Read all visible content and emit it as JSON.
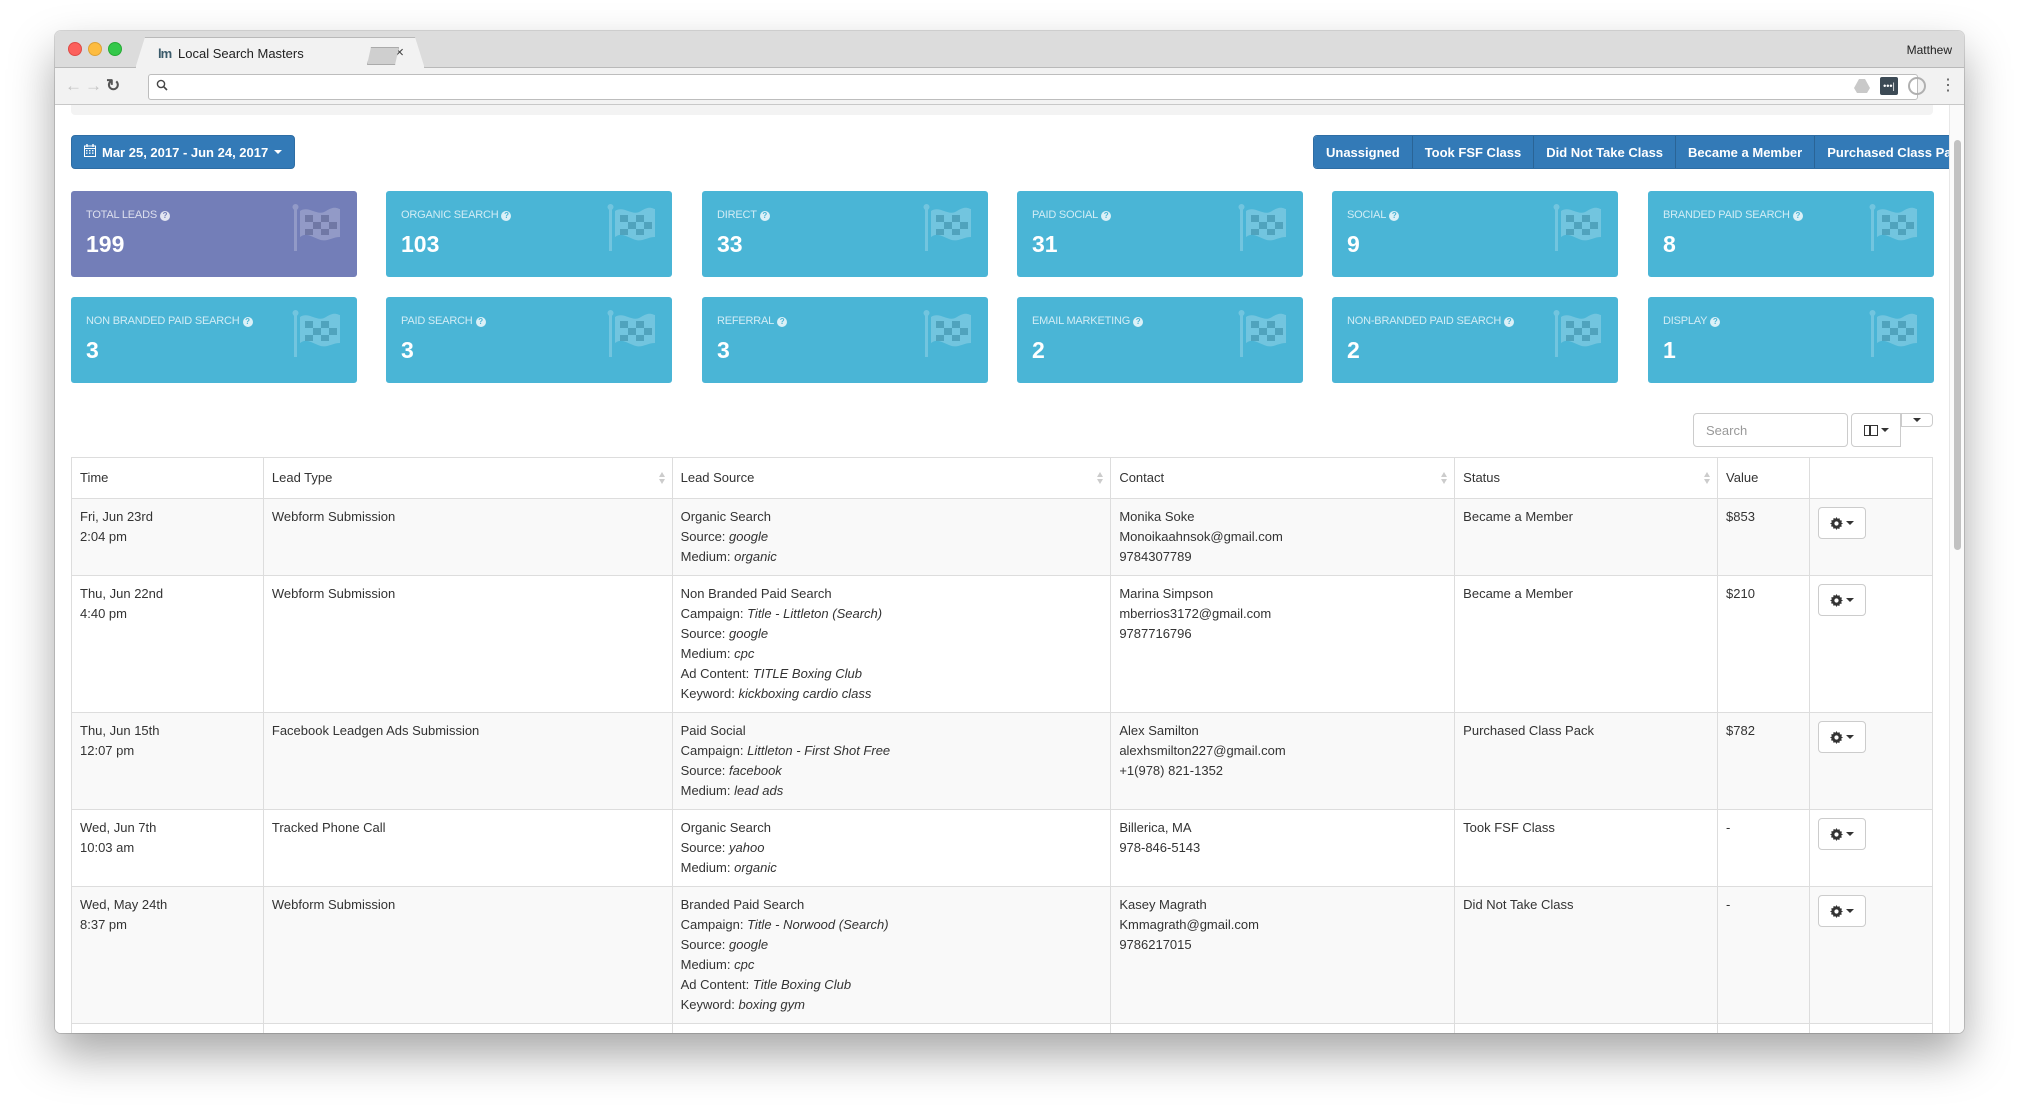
{
  "browser": {
    "tab_title": "Local Search Masters",
    "tab_favicon": "lm",
    "profile_name": "Matthew",
    "address_value": ""
  },
  "toolbar": {
    "date_range": "Mar 25, 2017 - Jun 24, 2017",
    "status_filters": [
      "Unassigned",
      "Took FSF Class",
      "Did Not Take Class",
      "Became a Member",
      "Purchased Class Pack"
    ]
  },
  "colors": {
    "primary": "#337ab7",
    "card_info": "#4ab5d6",
    "card_total": "#737eb8"
  },
  "stats": [
    {
      "label": "Total Leads",
      "value": "199"
    },
    {
      "label": "Organic Search",
      "value": "103"
    },
    {
      "label": "Direct",
      "value": "33"
    },
    {
      "label": "Paid Social",
      "value": "31"
    },
    {
      "label": "Social",
      "value": "9"
    },
    {
      "label": "Branded Paid Search",
      "value": "8"
    },
    {
      "label": "Non Branded Paid Search",
      "value": "3"
    },
    {
      "label": "Paid Search",
      "value": "3"
    },
    {
      "label": "Referral",
      "value": "3"
    },
    {
      "label": "Email Marketing",
      "value": "2"
    },
    {
      "label": "Non-Branded Paid Search",
      "value": "2"
    },
    {
      "label": "Display",
      "value": "1"
    }
  ],
  "table_tools": {
    "search_placeholder": "Search",
    "search_value": ""
  },
  "table": {
    "headers": [
      "Time",
      "Lead Type",
      "Lead Source",
      "Contact",
      "Status",
      "Value"
    ],
    "rows": [
      {
        "date": "Fri, Jun 23rd",
        "time": "2:04 pm",
        "lead_type": "Webform Submission",
        "source_name": "Organic Search",
        "source_details": [
          {
            "key": "Source:",
            "val": "google"
          },
          {
            "key": "Medium:",
            "val": "organic"
          }
        ],
        "contact": [
          "Monika Soke",
          "Monoikaahnsok@gmail.com",
          "9784307789"
        ],
        "status": "Became a Member",
        "value": "$853"
      },
      {
        "date": "Thu, Jun 22nd",
        "time": "4:40 pm",
        "lead_type": "Webform Submission",
        "source_name": "Non Branded Paid Search",
        "source_details": [
          {
            "key": "Campaign:",
            "val": "Title - Littleton (Search)"
          },
          {
            "key": "Source:",
            "val": "google"
          },
          {
            "key": "Medium:",
            "val": "cpc"
          },
          {
            "key": "Ad Content:",
            "val": "TITLE Boxing Club"
          },
          {
            "key": "Keyword:",
            "val": "kickboxing cardio class"
          }
        ],
        "contact": [
          "Marina Simpson",
          "mberrios3172@gmail.com",
          "9787716796"
        ],
        "status": "Became a Member",
        "value": "$210"
      },
      {
        "date": "Thu, Jun 15th",
        "time": "12:07 pm",
        "lead_type": "Facebook Leadgen Ads Submission",
        "source_name": "Paid Social",
        "source_details": [
          {
            "key": "Campaign:",
            "val": "Littleton - First Shot Free"
          },
          {
            "key": "Source:",
            "val": "facebook"
          },
          {
            "key": "Medium:",
            "val": "lead ads"
          }
        ],
        "contact": [
          "Alex Samilton",
          "alexhsmilton227@gmail.com",
          "+1(978) 821-1352"
        ],
        "status": "Purchased Class Pack",
        "value": "$782"
      },
      {
        "date": "Wed, Jun 7th",
        "time": "10:03 am",
        "lead_type": "Tracked Phone Call",
        "source_name": "Organic Search",
        "source_details": [
          {
            "key": "Source:",
            "val": "yahoo"
          },
          {
            "key": "Medium:",
            "val": "organic"
          }
        ],
        "contact": [
          "Billerica, MA",
          "978-846-5143"
        ],
        "status": "Took FSF Class",
        "value": "-"
      },
      {
        "date": "Wed, May 24th",
        "time": "8:37 pm",
        "lead_type": "Webform Submission",
        "source_name": "Branded Paid Search",
        "source_details": [
          {
            "key": "Campaign:",
            "val": "Title - Norwood (Search)"
          },
          {
            "key": "Source:",
            "val": "google"
          },
          {
            "key": "Medium:",
            "val": "cpc"
          },
          {
            "key": "Ad Content:",
            "val": "Title Boxing Club"
          },
          {
            "key": "Keyword:",
            "val": "boxing gym"
          }
        ],
        "contact": [
          "Kasey Magrath",
          "Kmmagrath@gmail.com",
          "9786217015"
        ],
        "status": "Did Not Take Class",
        "value": "-"
      }
    ]
  }
}
